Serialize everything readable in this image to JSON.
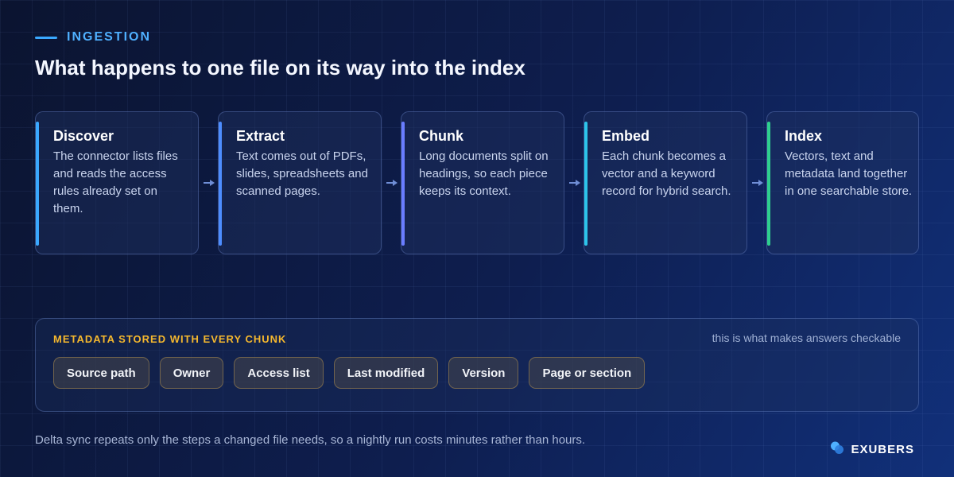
{
  "eyebrow": "INGESTION",
  "title": "What happens to one file on its way into the index",
  "steps": [
    {
      "name": "Discover",
      "desc": "The connector lists files and reads the access rules already set on them.",
      "accent": "#3aa8ff"
    },
    {
      "name": "Extract",
      "desc": "Text comes out of PDFs, slides, spreadsheets and scanned pages.",
      "accent": "#4d8dff"
    },
    {
      "name": "Chunk",
      "desc": "Long documents split on headings, so each piece keeps its context.",
      "accent": "#6a7dff"
    },
    {
      "name": "Embed",
      "desc": "Each chunk becomes a vector and a keyword record for hybrid search.",
      "accent": "#2cc4ea"
    },
    {
      "name": "Index",
      "desc": "Vectors, text and metadata land together in one searchable store.",
      "accent": "#2ecf8f"
    }
  ],
  "metadata": {
    "label": "METADATA STORED WITH EVERY CHUNK",
    "note": "this is what makes answers checkable",
    "chips": [
      "Source path",
      "Owner",
      "Access list",
      "Last modified",
      "Version",
      "Page or section"
    ]
  },
  "footer": "Delta sync repeats only the steps a changed file needs, so a nightly run costs minutes rather than hours.",
  "brand": {
    "name": "EXUBERS",
    "logo_icon": "droplets-icon",
    "color": "#4fb0ff"
  }
}
